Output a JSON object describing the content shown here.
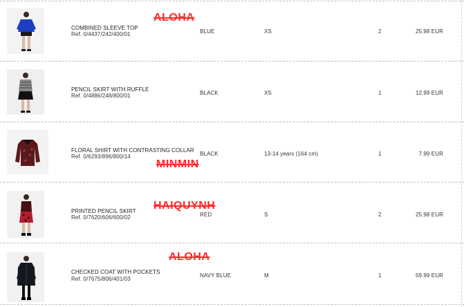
{
  "items": [
    {
      "name": "COMBINED SLEEVE TOP",
      "ref": "Ref. 0/4437/242/400/01",
      "color": "BLUE",
      "size": "XS",
      "qty": "2",
      "price": "25.98 EUR",
      "thumb_icon": "blue-top-product-photo"
    },
    {
      "name": "PENCIL SKIRT WITH RUFFLE",
      "ref": "Ref. 0/4886/248/800/01",
      "color": "BLACK",
      "size": "XS",
      "qty": "1",
      "price": "12.99 EUR",
      "thumb_icon": "pencil-skirt-product-photo"
    },
    {
      "name": "FLORAL SHIRT WITH CONTRASTING COLLAR",
      "ref": "Ref. 0/6293/896/800/14",
      "color": "BLACK",
      "size": "13-14 years (164 cm)",
      "qty": "1",
      "price": "7.99 EUR",
      "thumb_icon": "floral-shirt-product-photo"
    },
    {
      "name": "PRINTED PENCIL SKIRT",
      "ref": "Ref. 0/7620/606/600/02",
      "color": "RED",
      "size": "S",
      "qty": "2",
      "price": "25.98 EUR",
      "thumb_icon": "printed-skirt-product-photo"
    },
    {
      "name": "CHECKED COAT WITH POCKETS",
      "ref": "Ref. 0/7675/806/401/03",
      "color": "NAVY BLUE",
      "size": "M",
      "qty": "1",
      "price": "59.99 EUR",
      "thumb_icon": "checked-coat-product-photo"
    }
  ],
  "stamps": [
    "ALOHA",
    "MINMIN",
    "HAIQUYNH",
    "ALOHA"
  ],
  "colors": {
    "stamp": "#ff2b2b",
    "divider": "#bdbdbd"
  }
}
